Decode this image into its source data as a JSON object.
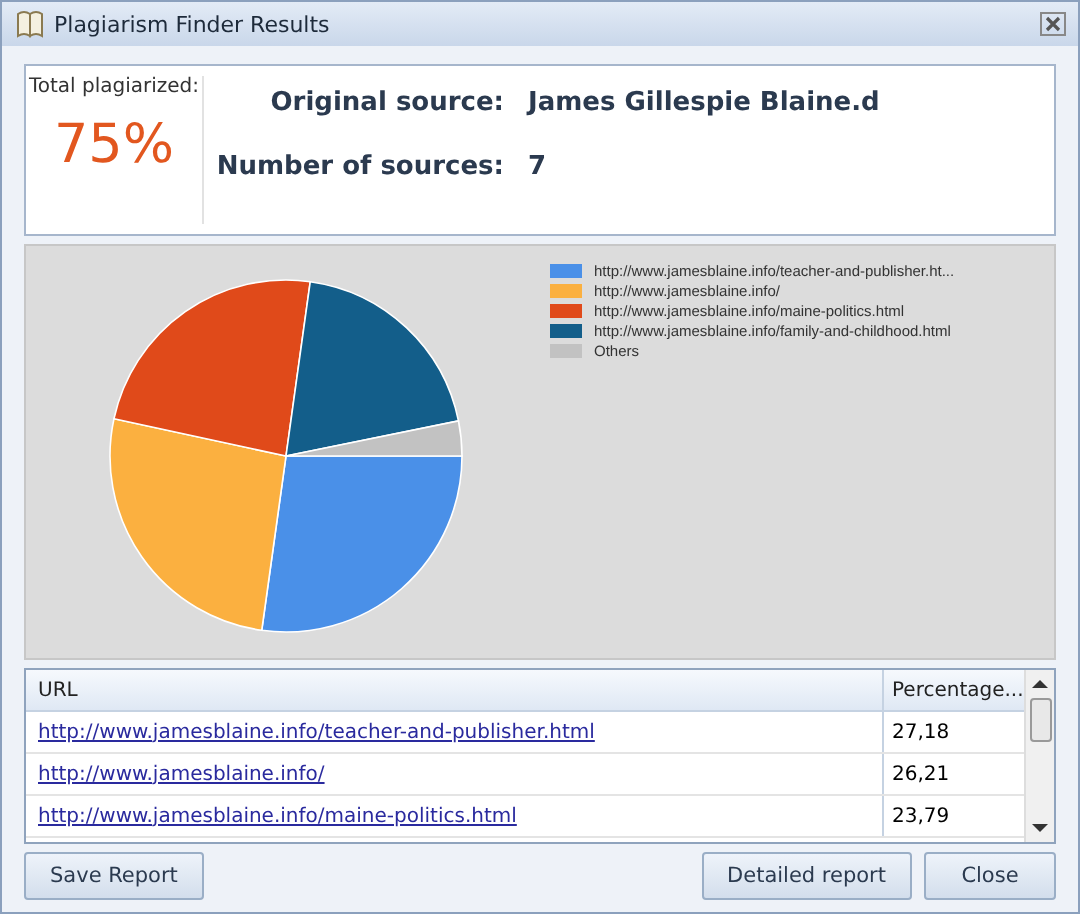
{
  "window": {
    "title": "Plagiarism Finder Results"
  },
  "summary": {
    "total_label": "Total plagiarized:",
    "total_value": "75%",
    "fields": [
      {
        "label": "Original source:",
        "value": "James Gillespie Blaine.d"
      },
      {
        "label": "Number of sources:",
        "value": "7"
      }
    ]
  },
  "legend": [
    {
      "label": "http://www.jamesblaine.info/teacher-and-publisher.ht...",
      "color": "#4a90e8"
    },
    {
      "label": "http://www.jamesblaine.info/",
      "color": "#fbb040"
    },
    {
      "label": "http://www.jamesblaine.info/maine-politics.html",
      "color": "#e04a1a"
    },
    {
      "label": "http://www.jamesblaine.info/family-and-childhood.html",
      "color": "#135e8a"
    },
    {
      "label": "Others",
      "color": "#c2c2c2"
    }
  ],
  "table": {
    "columns": [
      "URL",
      "Percentage..."
    ],
    "rows": [
      {
        "url": "http://www.jamesblaine.info/teacher-and-publisher.html",
        "percentage": "27,18"
      },
      {
        "url": "http://www.jamesblaine.info/",
        "percentage": "26,21"
      },
      {
        "url": "http://www.jamesblaine.info/maine-politics.html",
        "percentage": "23,79"
      }
    ]
  },
  "buttons": {
    "left": [
      "Save Report"
    ],
    "right": [
      "Detailed report",
      "Close"
    ]
  }
}
